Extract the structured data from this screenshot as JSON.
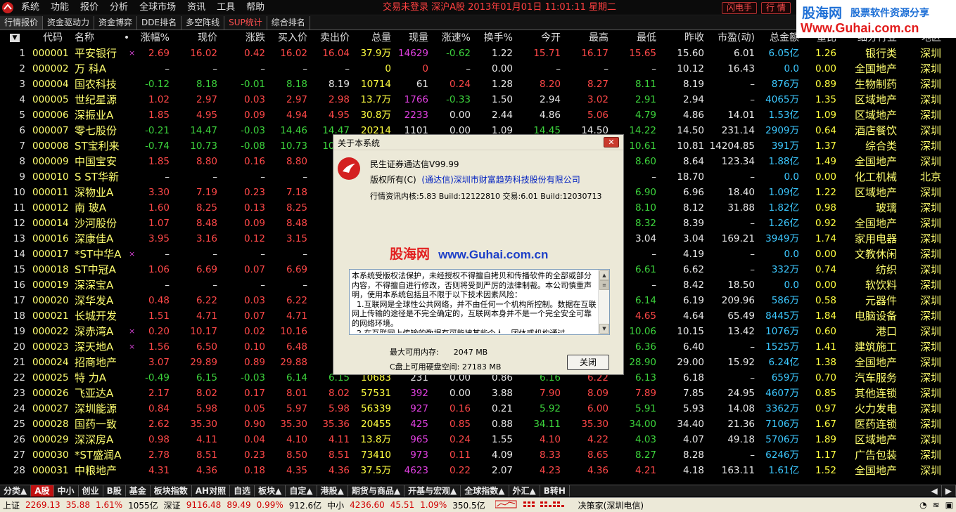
{
  "menubar": {
    "items": [
      "系统",
      "功能",
      "报价",
      "分析",
      "全球市场",
      "资讯",
      "工具",
      "帮助"
    ],
    "status": "交易未登录  深沪A股 2013年01月01日 11:01:11 星期二",
    "flash_button": "闪电手",
    "quote_button": "行 情"
  },
  "watermark_top": {
    "line1a": "股海网",
    "line1b": "股票软件资源分享",
    "line2": "Www.Guhai.com.cn"
  },
  "top_tabs": [
    "行情报价",
    "资金驱动力",
    "资金博弈",
    "DDE排名",
    "多空阵线",
    "SUP统计",
    "综合排名"
  ],
  "columns": [
    "代码",
    "名称",
    "•",
    "涨幅%",
    "现价",
    "涨跌",
    "买入价",
    "卖出价",
    "总量",
    "现量",
    "涨速%",
    "换手%",
    "今开",
    "最高",
    "最低",
    "昨收",
    "市盈(动)",
    "总金额",
    "量比",
    "细分行业",
    "地区"
  ],
  "rows": [
    {
      "idx": "1",
      "code": "000001",
      "name": "平安银行",
      "x": "×",
      "pct": "2.69",
      "price": "16.02",
      "chg": "0.42",
      "bid": "16.02",
      "ask": "16.04",
      "vol": "37.9万",
      "cur": "14629",
      "spd": "-0.62",
      "turn": "1.22",
      "open": "15.71",
      "high": "16.17",
      "low": "15.65",
      "prev": "15.60",
      "pe": "6.01",
      "amt": "6.05亿",
      "vr": "1.26",
      "ind": "银行类",
      "area": "深圳"
    },
    {
      "idx": "2",
      "code": "000002",
      "name": "万  科A",
      "x": "",
      "pct": "–",
      "price": "–",
      "chg": "–",
      "bid": "–",
      "ask": "–",
      "vol": "0",
      "cur": "0",
      "spd": "–",
      "turn": "0.00",
      "open": "–",
      "high": "–",
      "low": "–",
      "prev": "10.12",
      "pe": "16.43",
      "amt": "0.0",
      "vr": "0.00",
      "ind": "全国地产",
      "area": "深圳"
    },
    {
      "idx": "3",
      "code": "000004",
      "name": "国农科技",
      "x": "",
      "pct": "-0.12",
      "price": "8.18",
      "chg": "-0.01",
      "bid": "8.18",
      "ask": "8.19",
      "vol": "10714",
      "cur": "61",
      "spd": "0.24",
      "turn": "1.28",
      "open": "8.20",
      "high": "8.27",
      "low": "8.11",
      "prev": "8.19",
      "pe": "–",
      "amt": "876万",
      "vr": "0.89",
      "ind": "生物制药",
      "area": "深圳"
    },
    {
      "idx": "4",
      "code": "000005",
      "name": "世纪星源",
      "x": "",
      "pct": "1.02",
      "price": "2.97",
      "chg": "0.03",
      "bid": "2.97",
      "ask": "2.98",
      "vol": "13.7万",
      "cur": "1766",
      "spd": "-0.33",
      "turn": "1.50",
      "open": "2.94",
      "high": "3.02",
      "low": "2.91",
      "prev": "2.94",
      "pe": "–",
      "amt": "4065万",
      "vr": "1.35",
      "ind": "区域地产",
      "area": "深圳"
    },
    {
      "idx": "5",
      "code": "000006",
      "name": "深振业A",
      "x": "",
      "pct": "1.85",
      "price": "4.95",
      "chg": "0.09",
      "bid": "4.94",
      "ask": "4.95",
      "vol": "30.8万",
      "cur": "2233",
      "spd": "0.00",
      "turn": "2.44",
      "open": "4.86",
      "high": "5.06",
      "low": "4.79",
      "prev": "4.86",
      "pe": "14.01",
      "amt": "1.53亿",
      "vr": "1.09",
      "ind": "区域地产",
      "area": "深圳"
    },
    {
      "idx": "6",
      "code": "000007",
      "name": "零七股份",
      "x": "",
      "pct": "-0.21",
      "price": "14.47",
      "chg": "-0.03",
      "bid": "14.46",
      "ask": "14.47",
      "vol": "20214",
      "cur": "1101",
      "spd": "0.00",
      "turn": "1.09",
      "open": "14.45",
      "high": "14.50",
      "low": "14.22",
      "prev": "14.50",
      "pe": "231.14",
      "amt": "2909万",
      "vr": "0.64",
      "ind": "酒店餐饮",
      "area": "深圳"
    },
    {
      "idx": "7",
      "code": "000008",
      "name": "ST宝利来",
      "x": "",
      "pct": "-0.74",
      "price": "10.73",
      "chg": "-0.08",
      "bid": "10.73",
      "ask": "10.74",
      "vol": "",
      "cur": "",
      "spd": "",
      "turn": "",
      "open": "",
      "high": "",
      "low": "10.61",
      "prev": "10.81",
      "pe": "14204.85",
      "amt": "391万",
      "vr": "1.37",
      "ind": "综合类",
      "area": "深圳"
    },
    {
      "idx": "8",
      "code": "000009",
      "name": "中国宝安",
      "x": "",
      "pct": "1.85",
      "price": "8.80",
      "chg": "0.16",
      "bid": "8.80",
      "ask": "",
      "vol": "",
      "cur": "",
      "spd": "",
      "turn": "",
      "open": "",
      "high": "",
      "low": "8.60",
      "prev": "8.64",
      "pe": "123.34",
      "amt": "1.88亿",
      "vr": "1.49",
      "ind": "全国地产",
      "area": "深圳"
    },
    {
      "idx": "9",
      "code": "000010",
      "name": "S ST华新",
      "x": "",
      "pct": "–",
      "price": "–",
      "chg": "–",
      "bid": "–",
      "ask": "",
      "vol": "",
      "cur": "",
      "spd": "",
      "turn": "",
      "open": "",
      "high": "",
      "low": "–",
      "prev": "18.70",
      "pe": "–",
      "amt": "0.0",
      "vr": "0.00",
      "ind": "化工机械",
      "area": "北京"
    },
    {
      "idx": "10",
      "code": "000011",
      "name": "深物业A",
      "x": "",
      "pct": "3.30",
      "price": "7.19",
      "chg": "0.23",
      "bid": "7.18",
      "ask": "",
      "vol": "",
      "cur": "",
      "spd": "",
      "turn": "",
      "open": "",
      "high": "",
      "low": "6.90",
      "prev": "6.96",
      "pe": "18.40",
      "amt": "1.09亿",
      "vr": "1.22",
      "ind": "区域地产",
      "area": "深圳"
    },
    {
      "idx": "11",
      "code": "000012",
      "name": "南  玻A",
      "x": "",
      "pct": "1.60",
      "price": "8.25",
      "chg": "0.13",
      "bid": "8.25",
      "ask": "",
      "vol": "",
      "cur": "",
      "spd": "",
      "turn": "",
      "open": "",
      "high": "",
      "low": "8.10",
      "prev": "8.12",
      "pe": "31.88",
      "amt": "1.82亿",
      "vr": "0.98",
      "ind": "玻璃",
      "area": "深圳"
    },
    {
      "idx": "12",
      "code": "000014",
      "name": "沙河股份",
      "x": "",
      "pct": "1.07",
      "price": "8.48",
      "chg": "0.09",
      "bid": "8.48",
      "ask": "",
      "vol": "",
      "cur": "",
      "spd": "",
      "turn": "",
      "open": "",
      "high": "",
      "low": "8.32",
      "prev": "8.39",
      "pe": "–",
      "amt": "1.26亿",
      "vr": "0.92",
      "ind": "全国地产",
      "area": "深圳"
    },
    {
      "idx": "13",
      "code": "000016",
      "name": "深康佳A",
      "x": "",
      "pct": "3.95",
      "price": "3.16",
      "chg": "0.12",
      "bid": "3.15",
      "ask": "",
      "vol": "",
      "cur": "",
      "spd": "",
      "turn": "",
      "open": "",
      "high": "",
      "low": "3.04",
      "prev": "3.04",
      "pe": "169.21",
      "amt": "3949万",
      "vr": "1.74",
      "ind": "家用电器",
      "area": "深圳"
    },
    {
      "idx": "14",
      "code": "000017",
      "name": "*ST中华A",
      "x": "×",
      "pct": "–",
      "price": "–",
      "chg": "–",
      "bid": "–",
      "ask": "",
      "vol": "",
      "cur": "",
      "spd": "",
      "turn": "",
      "open": "",
      "high": "",
      "low": "–",
      "prev": "4.19",
      "pe": "–",
      "amt": "0.0",
      "vr": "0.00",
      "ind": "文教休闲",
      "area": "深圳"
    },
    {
      "idx": "15",
      "code": "000018",
      "name": "ST中冠A",
      "x": "",
      "pct": "1.06",
      "price": "6.69",
      "chg": "0.07",
      "bid": "6.69",
      "ask": "",
      "vol": "",
      "cur": "",
      "spd": "",
      "turn": "",
      "open": "",
      "high": "",
      "low": "6.61",
      "prev": "6.62",
      "pe": "–",
      "amt": "332万",
      "vr": "0.74",
      "ind": "纺织",
      "area": "深圳"
    },
    {
      "idx": "16",
      "code": "000019",
      "name": "深深宝A",
      "x": "",
      "pct": "–",
      "price": "–",
      "chg": "–",
      "bid": "–",
      "ask": "",
      "vol": "",
      "cur": "",
      "spd": "",
      "turn": "",
      "open": "",
      "high": "",
      "low": "–",
      "prev": "8.42",
      "pe": "18.50",
      "amt": "0.0",
      "vr": "0.00",
      "ind": "软饮料",
      "area": "深圳"
    },
    {
      "idx": "17",
      "code": "000020",
      "name": "深华发A",
      "x": "",
      "pct": "0.48",
      "price": "6.22",
      "chg": "0.03",
      "bid": "6.22",
      "ask": "",
      "vol": "",
      "cur": "",
      "spd": "",
      "turn": "",
      "open": "",
      "high": "",
      "low": "6.14",
      "prev": "6.19",
      "pe": "209.96",
      "amt": "586万",
      "vr": "0.58",
      "ind": "元器件",
      "area": "深圳"
    },
    {
      "idx": "18",
      "code": "000021",
      "name": "长城开发",
      "x": "",
      "pct": "1.51",
      "price": "4.71",
      "chg": "0.07",
      "bid": "4.71",
      "ask": "",
      "vol": "",
      "cur": "",
      "spd": "",
      "turn": "",
      "open": "",
      "high": "",
      "low": "4.65",
      "prev": "4.64",
      "pe": "65.49",
      "amt": "8445万",
      "vr": "1.84",
      "ind": "电脑设备",
      "area": "深圳"
    },
    {
      "idx": "19",
      "code": "000022",
      "name": "深赤湾A",
      "x": "×",
      "pct": "0.20",
      "price": "10.17",
      "chg": "0.02",
      "bid": "10.16",
      "ask": "10",
      "vol": "",
      "cur": "",
      "spd": "",
      "turn": "",
      "open": "",
      "high": "",
      "low": "10.06",
      "prev": "10.15",
      "pe": "13.42",
      "amt": "1076万",
      "vr": "0.60",
      "ind": "港口",
      "area": "深圳"
    },
    {
      "idx": "20",
      "code": "000023",
      "name": "深天地A",
      "x": "×",
      "pct": "1.56",
      "price": "6.50",
      "chg": "0.10",
      "bid": "6.48",
      "ask": "",
      "vol": "",
      "cur": "",
      "spd": "",
      "turn": "",
      "open": "",
      "high": "",
      "low": "6.36",
      "prev": "6.40",
      "pe": "–",
      "amt": "1525万",
      "vr": "1.41",
      "ind": "建筑施工",
      "area": "深圳"
    },
    {
      "idx": "21",
      "code": "000024",
      "name": "招商地产",
      "x": "",
      "pct": "3.07",
      "price": "29.89",
      "chg": "0.89",
      "bid": "29.88",
      "ask": "29",
      "vol": "",
      "cur": "",
      "spd": "",
      "turn": "",
      "open": "",
      "high": "",
      "low": "28.90",
      "prev": "29.00",
      "pe": "15.92",
      "amt": "6.24亿",
      "vr": "1.38",
      "ind": "全国地产",
      "area": "深圳"
    },
    {
      "idx": "22",
      "code": "000025",
      "name": "特  力A",
      "x": "",
      "pct": "-0.49",
      "price": "6.15",
      "chg": "-0.03",
      "bid": "6.14",
      "ask": "6.15",
      "vol": "10683",
      "cur": "231",
      "spd": "0.00",
      "turn": "0.86",
      "open": "6.16",
      "high": "6.22",
      "low": "6.13",
      "prev": "6.18",
      "pe": "–",
      "amt": "659万",
      "vr": "0.70",
      "ind": "汽车服务",
      "area": "深圳"
    },
    {
      "idx": "23",
      "code": "000026",
      "name": "飞亚达A",
      "x": "",
      "pct": "2.17",
      "price": "8.02",
      "chg": "0.17",
      "bid": "8.01",
      "ask": "8.02",
      "vol": "57531",
      "cur": "392",
      "spd": "0.00",
      "turn": "3.88",
      "open": "7.90",
      "high": "8.09",
      "low": "7.89",
      "prev": "7.85",
      "pe": "24.95",
      "amt": "4607万",
      "vr": "0.85",
      "ind": "其他连锁",
      "area": "深圳"
    },
    {
      "idx": "24",
      "code": "000027",
      "name": "深圳能源",
      "x": "",
      "pct": "0.84",
      "price": "5.98",
      "chg": "0.05",
      "bid": "5.97",
      "ask": "5.98",
      "vol": "56339",
      "cur": "927",
      "spd": "0.16",
      "turn": "0.21",
      "open": "5.92",
      "high": "6.00",
      "low": "5.91",
      "prev": "5.93",
      "pe": "14.08",
      "amt": "3362万",
      "vr": "0.97",
      "ind": "火力发电",
      "area": "深圳"
    },
    {
      "idx": "25",
      "code": "000028",
      "name": "国药一致",
      "x": "",
      "pct": "2.62",
      "price": "35.30",
      "chg": "0.90",
      "bid": "35.30",
      "ask": "35.36",
      "vol": "20455",
      "cur": "425",
      "spd": "0.85",
      "turn": "0.88",
      "open": "34.11",
      "high": "35.30",
      "low": "34.00",
      "prev": "34.40",
      "pe": "21.36",
      "amt": "7106万",
      "vr": "1.67",
      "ind": "医药连锁",
      "area": "深圳"
    },
    {
      "idx": "26",
      "code": "000029",
      "name": "深深房A",
      "x": "",
      "pct": "0.98",
      "price": "4.11",
      "chg": "0.04",
      "bid": "4.10",
      "ask": "4.11",
      "vol": "13.8万",
      "cur": "965",
      "spd": "0.24",
      "turn": "1.55",
      "open": "4.10",
      "high": "4.22",
      "low": "4.03",
      "prev": "4.07",
      "pe": "49.18",
      "amt": "5706万",
      "vr": "1.89",
      "ind": "区域地产",
      "area": "深圳"
    },
    {
      "idx": "27",
      "code": "000030",
      "name": "*ST盛润A",
      "x": "",
      "pct": "2.78",
      "price": "8.51",
      "chg": "0.23",
      "bid": "8.50",
      "ask": "8.51",
      "vol": "73410",
      "cur": "973",
      "spd": "0.11",
      "turn": "4.09",
      "open": "8.33",
      "high": "8.65",
      "low": "8.27",
      "prev": "8.28",
      "pe": "–",
      "amt": "6246万",
      "vr": "1.17",
      "ind": "广告包装",
      "area": "深圳"
    },
    {
      "idx": "28",
      "code": "000031",
      "name": "中粮地产",
      "x": "",
      "pct": "4.31",
      "price": "4.36",
      "chg": "0.18",
      "bid": "4.35",
      "ask": "4.36",
      "vol": "37.5万",
      "cur": "4623",
      "spd": "0.22",
      "turn": "2.07",
      "open": "4.23",
      "high": "4.36",
      "low": "4.21",
      "prev": "4.18",
      "pe": "163.11",
      "amt": "1.61亿",
      "vr": "1.52",
      "ind": "全国地产",
      "area": "深圳"
    }
  ],
  "bottom_tabs": [
    "分类▲",
    "A股",
    "中小",
    "创业",
    "B股",
    "基金",
    "板块指数",
    "AH对照",
    "自选",
    "板块▲",
    "自定▲",
    "港股▲",
    "期货与商品▲",
    "开基与宏观▲",
    "全球指数▲",
    "外汇▲",
    "B转H"
  ],
  "statusbar": {
    "sh_label": "上证",
    "sh_value": "2269.13",
    "sh_chg": "35.88",
    "sh_pct": "1.61%",
    "sh_amt": "1055亿",
    "sz_label": "深证",
    "sz_value": "9116.48",
    "sz_chg": "89.49",
    "sz_pct": "0.99%",
    "sz_amt": "912.6亿",
    "zx_label": "中小",
    "zx_value": "4236.60",
    "zx_chg": "45.51",
    "zx_pct": "1.09%",
    "zx_amt": "350.5亿",
    "server": "决策家(深圳电信)"
  },
  "about_dialog": {
    "title": "关于本系统",
    "close_icon": "close-icon",
    "product": "民生证券通达信V99.99",
    "copyright_label": "版权所有(C)",
    "copyright_owner": "(通达信)深圳市财富趋势科技股份有限公司",
    "version": "行情资讯内核:5.83 Build:12122810  交易:6.01 Build:12030713",
    "watermark_cn": "股海网",
    "watermark_url": "www.Guhai.com.cn",
    "license_text": "本系统受版权法保护，未经授权不得擅自拷贝和传播软件的全部或部分内容，不得擅自进行修改，否则将受到严厉的法律制裁。本公司慎重声明，使用本系统包括且不限于以下技术因素风险：\n  1.互联网是全球性公共网络，并不由任何一个机构所控制。数据在互联网上传输的途径是不完全确定的，互联网本身并不是一个完全安全可靠的网络环境。\n  2.在互联网上传输的数据有可能被某些个人、团体或机构通过",
    "memory_label": "最大可用内存:",
    "memory_value": "2047 MB",
    "disk_label": "C盘上可用硬盘空间:",
    "disk_value": "27183 MB",
    "ok_button": "关闭"
  },
  "colors": {
    "up": "#ff4848",
    "down": "#3cd33c",
    "code": "#ffff70",
    "accent": "#c01010"
  }
}
